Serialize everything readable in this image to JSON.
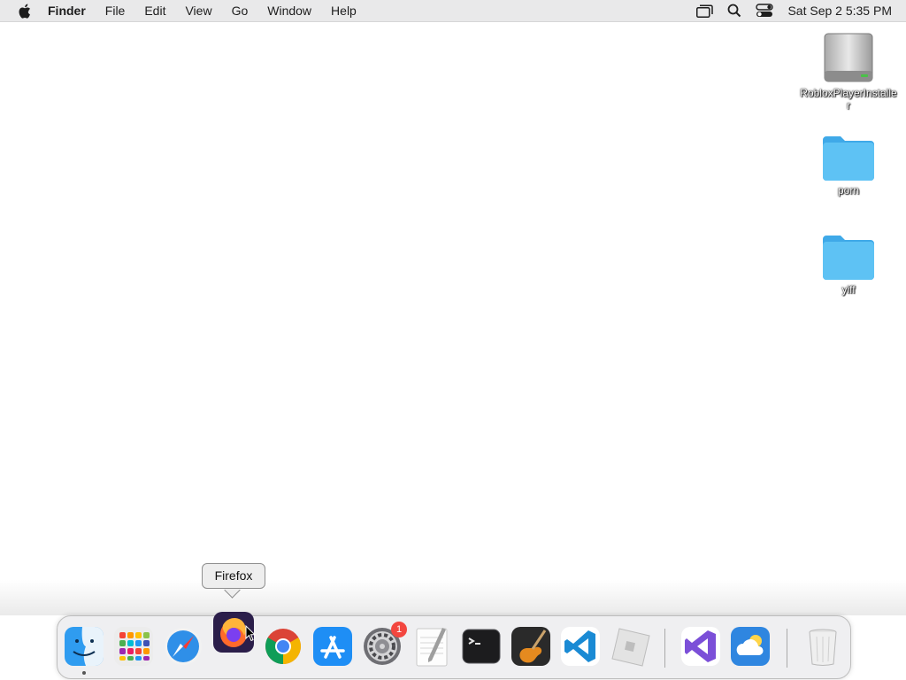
{
  "menubar": {
    "apple_icon": "apple-logo-icon",
    "app_name": "Finder",
    "menus": [
      "File",
      "Edit",
      "View",
      "Go",
      "Window",
      "Help"
    ],
    "status_icons": [
      "window-overview-icon",
      "search-icon",
      "control-center-icon"
    ],
    "clock": "Sat Sep 2  5:35 PM"
  },
  "desktop": {
    "items": [
      {
        "label": "RobloxPlayerInstaller",
        "icon": "disk-image-icon"
      },
      {
        "label": "porn",
        "icon": "folder-icon"
      },
      {
        "label": "yiff",
        "icon": "folder-icon"
      }
    ]
  },
  "dock": {
    "tooltip": "Firefox",
    "system_settings_badge": "1",
    "apps": [
      {
        "name": "Finder",
        "icon": "finder-icon"
      },
      {
        "name": "Launchpad",
        "icon": "launchpad-icon"
      },
      {
        "name": "Safari",
        "icon": "safari-icon"
      },
      {
        "name": "Firefox",
        "icon": "firefox-icon"
      },
      {
        "name": "Google Chrome",
        "icon": "chrome-icon"
      },
      {
        "name": "App Store",
        "icon": "app-store-icon"
      },
      {
        "name": "System Settings",
        "icon": "system-settings-icon"
      },
      {
        "name": "TextEdit",
        "icon": "textedit-icon"
      },
      {
        "name": "Terminal",
        "icon": "terminal-icon"
      },
      {
        "name": "GarageBand",
        "icon": "garageband-icon"
      },
      {
        "name": "Visual Studio Code",
        "icon": "vscode-icon"
      },
      {
        "name": "Roblox",
        "icon": "roblox-icon"
      },
      {
        "name": "Visual Studio",
        "icon": "visual-studio-icon"
      },
      {
        "name": "Weather",
        "icon": "weather-icon"
      },
      {
        "name": "Trash",
        "icon": "trash-icon"
      }
    ]
  },
  "colors": {
    "menubar_bg": "#e9e9ea",
    "folder_blue": "#5ec2f4",
    "badge_red": "#f3463f"
  }
}
